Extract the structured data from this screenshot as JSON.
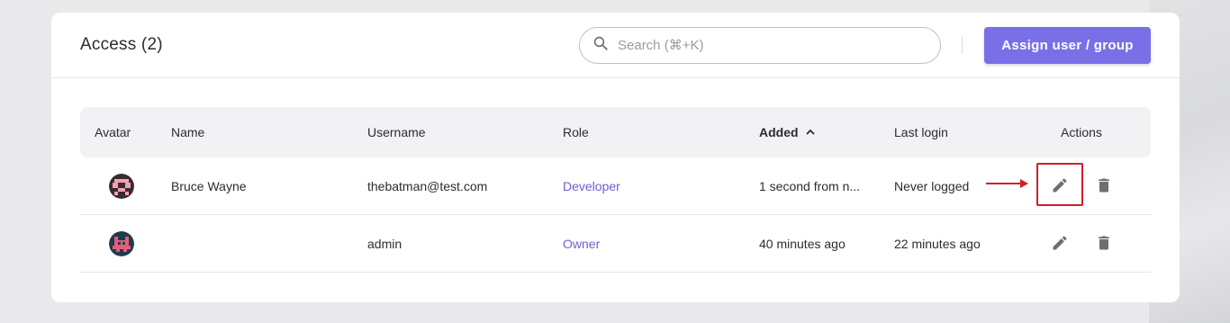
{
  "header": {
    "title": "Access (2)",
    "search_placeholder": "Search (⌘+K)",
    "assign_button": "Assign user / group"
  },
  "table": {
    "columns": {
      "avatar": "Avatar",
      "name": "Name",
      "username": "Username",
      "role": "Role",
      "added": "Added",
      "last_login": "Last login",
      "actions": "Actions"
    },
    "sort": {
      "column": "Added",
      "direction": "ascending"
    },
    "rows": [
      {
        "name": "Bruce Wayne",
        "username": "thebatman@test.com",
        "role": "Developer",
        "added": "1 second from n...",
        "last_login": "Never logged"
      },
      {
        "name": "",
        "username": "admin",
        "role": "Owner",
        "added": "40 minutes ago",
        "last_login": "22 minutes ago"
      }
    ]
  },
  "colors": {
    "accent": "#7b6fe8",
    "role_text": "#6b5fd6",
    "highlight": "#d0202a",
    "icon_gray": "#6e6e73"
  },
  "icons": [
    "search-icon",
    "sort-up-icon",
    "edit-icon",
    "delete-icon",
    "arrow-right-icon"
  ]
}
